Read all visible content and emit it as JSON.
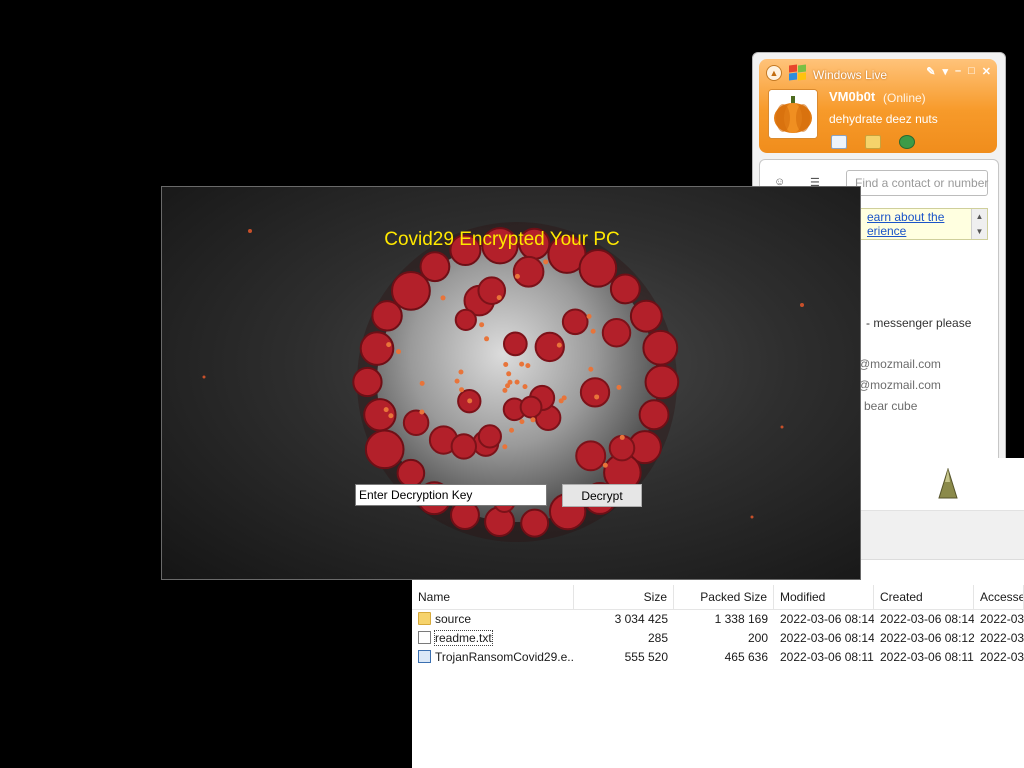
{
  "messenger": {
    "title": "Windows Live",
    "user_name": "VM0b0t",
    "status": "(Online)",
    "personal_message": "dehydrate deez nuts",
    "search_placeholder": "Find a contact or number",
    "ad_line1": "earn about the",
    "ad_line2": "erience",
    "contacts": [
      "- messenger please",
      "@mozmail.com",
      "@mozmail.com",
      "bear cube"
    ],
    "icons": [
      "mail-icon",
      "folder-icon",
      "spaces-icon"
    ]
  },
  "ransomware": {
    "title": "Covid29 Encrypted Your PC",
    "input_value": "Enter Decryption Key",
    "decrypt_label": "Decrypt",
    "title_color": "#ffe800"
  },
  "archive": {
    "columns": [
      "Name",
      "Size",
      "Packed Size",
      "Modified",
      "Created",
      "Accessed"
    ],
    "rows": [
      {
        "name": "source",
        "size": "3 034 425",
        "packed": "1 338 169",
        "modified": "2022-03-06 08:14",
        "created": "2022-03-06 08:14",
        "accessed": "2022-03-",
        "type": "folder"
      },
      {
        "name": "readme.txt",
        "size": "285",
        "packed": "200",
        "modified": "2022-03-06 08:14",
        "created": "2022-03-06 08:12",
        "accessed": "2022-03-",
        "type": "txt"
      },
      {
        "name": "TrojanRansomCovid29.e...",
        "size": "555 520",
        "packed": "465 636",
        "modified": "2022-03-06 08:11",
        "created": "2022-03-06 08:11",
        "accessed": "2022-03-",
        "type": "exe"
      }
    ]
  },
  "colors": {
    "desktop": "#000000",
    "messenger_orange": "#f79a2a",
    "virus_red": "#b3202a",
    "link_blue": "#1b54c8"
  }
}
